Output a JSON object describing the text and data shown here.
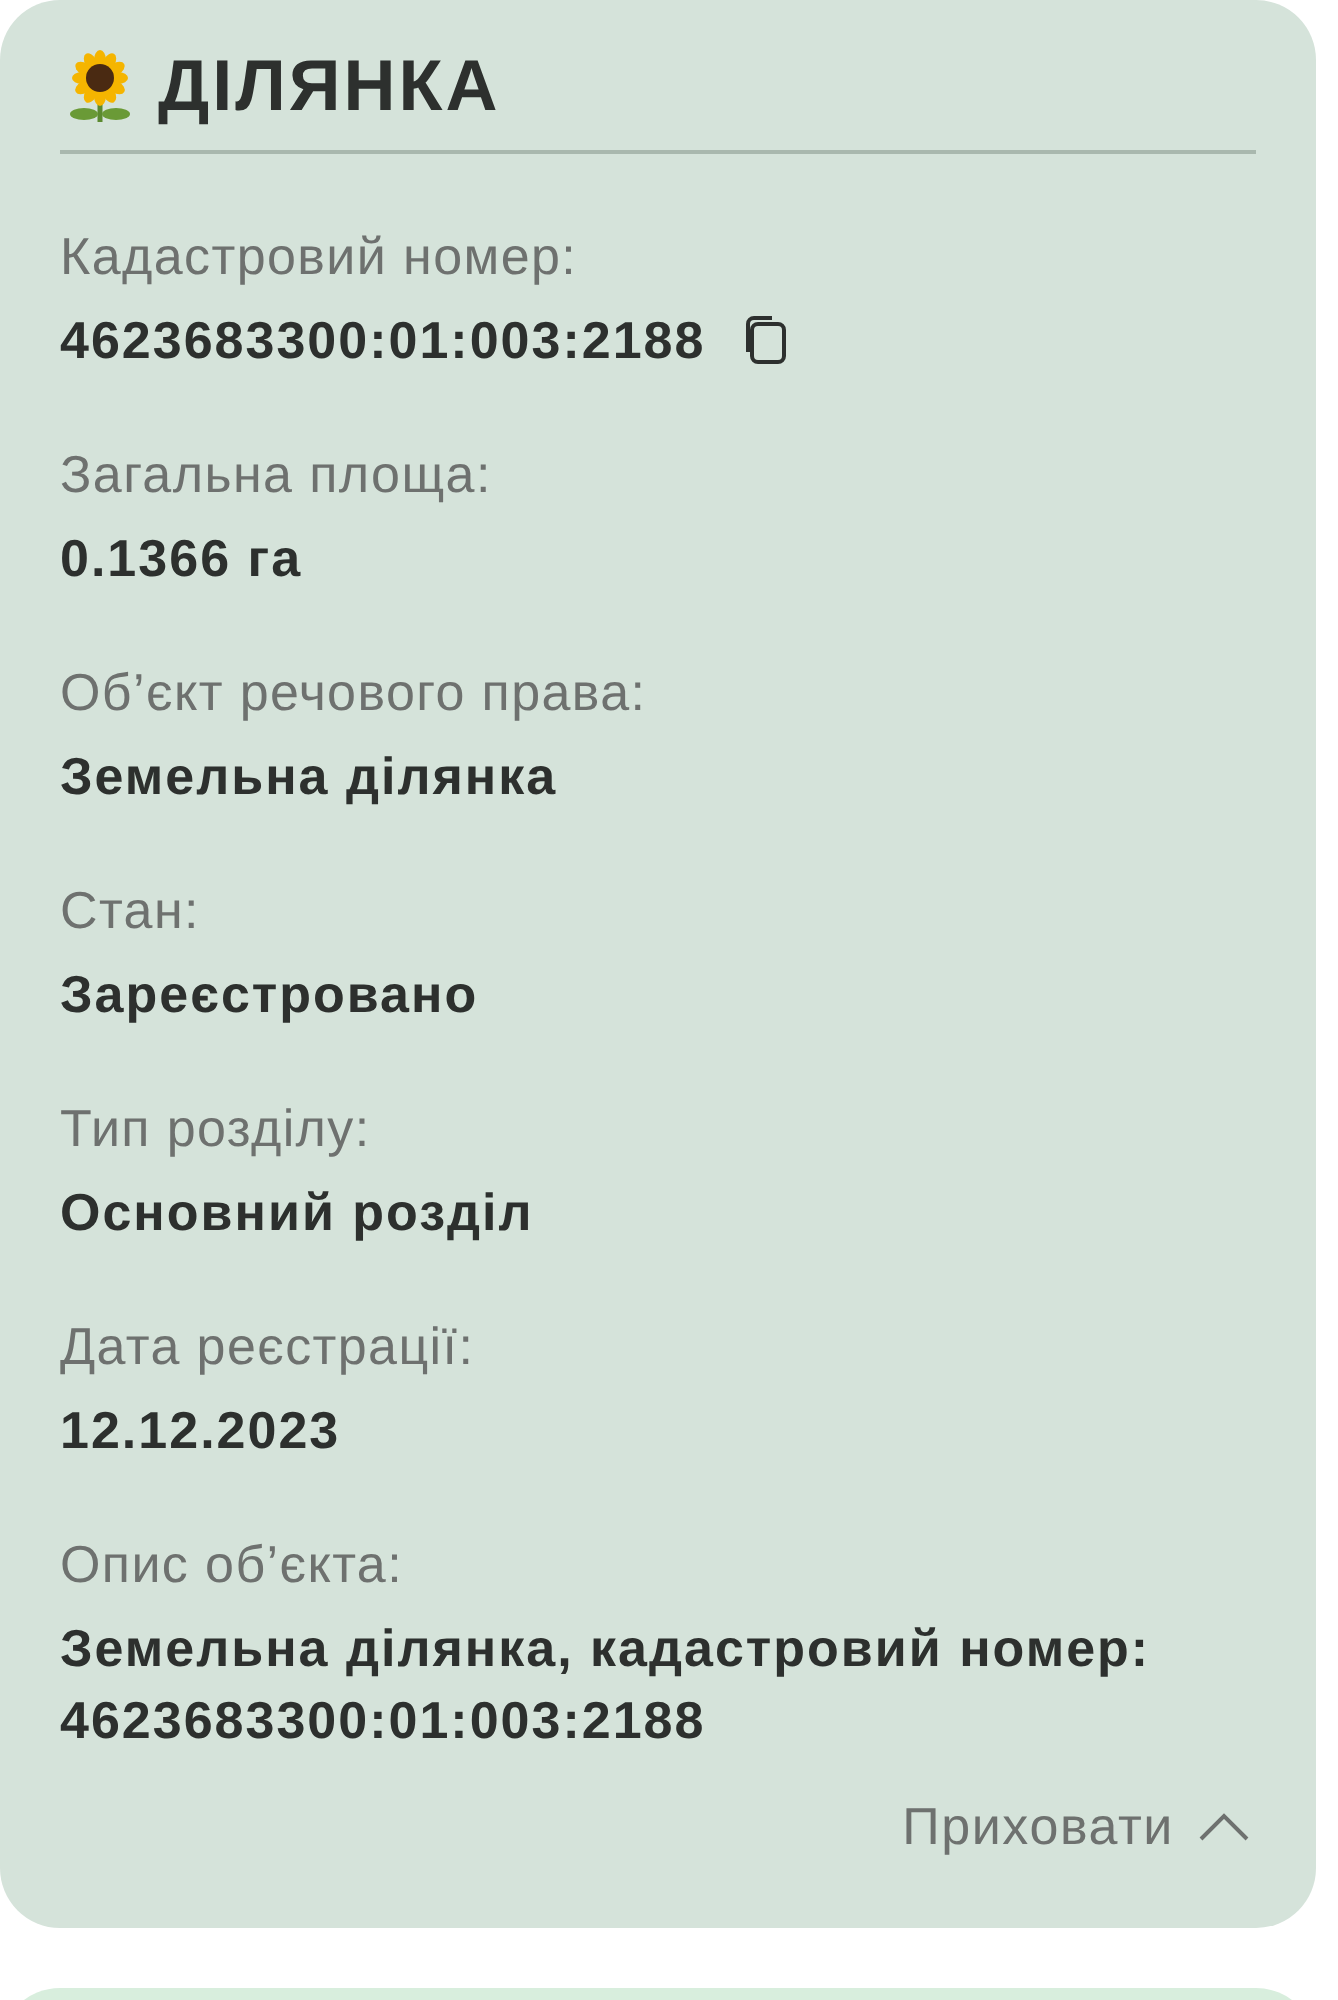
{
  "section": {
    "title": "ДІЛЯНКА",
    "fields": [
      {
        "label": "Кадастровий номер:",
        "value": "4623683300:01:003:2188",
        "copyable": true
      },
      {
        "label": "Загальна площа:",
        "value": "0.1366 га",
        "copyable": false
      },
      {
        "label": "Об’єкт речового права:",
        "value": "Земельна ділянка",
        "copyable": false
      },
      {
        "label": "Стан:",
        "value": "Зареєстровано",
        "copyable": false
      },
      {
        "label": "Тип розділу:",
        "value": "Основний розділ",
        "copyable": false
      },
      {
        "label": "Дата реєстрації:",
        "value": "12.12.2023",
        "copyable": false
      },
      {
        "label": "Опис об’єкта:",
        "value": "Земельна ділянка, кадастровий номер: 4623683300:01:003:2188",
        "copyable": false
      }
    ],
    "toggle": {
      "label": "Приховати",
      "expanded": true
    }
  }
}
